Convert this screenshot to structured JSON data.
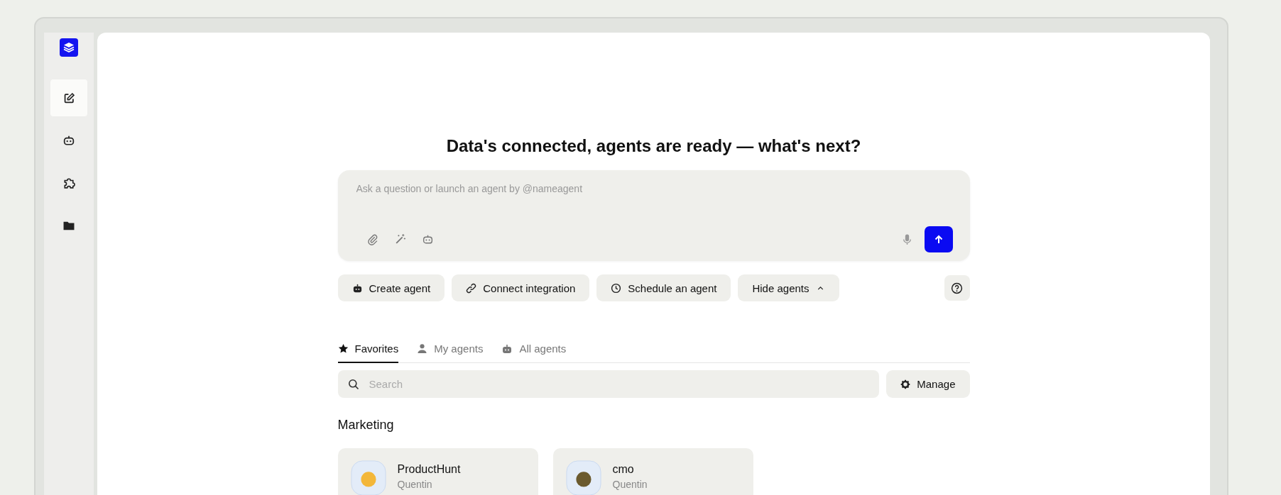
{
  "sidebar": {
    "items": [
      {
        "kind": "edit",
        "selected": true
      },
      {
        "kind": "robot",
        "selected": false
      },
      {
        "kind": "puzzle",
        "selected": false
      },
      {
        "kind": "folder",
        "selected": false
      }
    ]
  },
  "heading": "Data's connected, agents are ready — what's next?",
  "composer": {
    "placeholder": "Ask a question or launch an agent by @nameagent"
  },
  "actions": [
    {
      "label": "Create agent",
      "kind": "robot"
    },
    {
      "label": "Connect integration",
      "kind": "link"
    },
    {
      "label": "Schedule an agent",
      "kind": "clock"
    },
    {
      "label": "Hide agents",
      "kind": "caret"
    }
  ],
  "tabs": [
    {
      "label": "Favorites",
      "kind": "star",
      "selected": true
    },
    {
      "label": "My agents",
      "kind": "person",
      "selected": false
    },
    {
      "label": "All agents",
      "kind": "robot",
      "selected": false
    }
  ],
  "search": {
    "placeholder": "Search"
  },
  "manage_button": "Manage",
  "section_title": "Marketing",
  "agents": [
    {
      "name": "ProductHunt",
      "owner": "Quentin"
    },
    {
      "name": "cmo",
      "owner": "Quentin"
    }
  ]
}
